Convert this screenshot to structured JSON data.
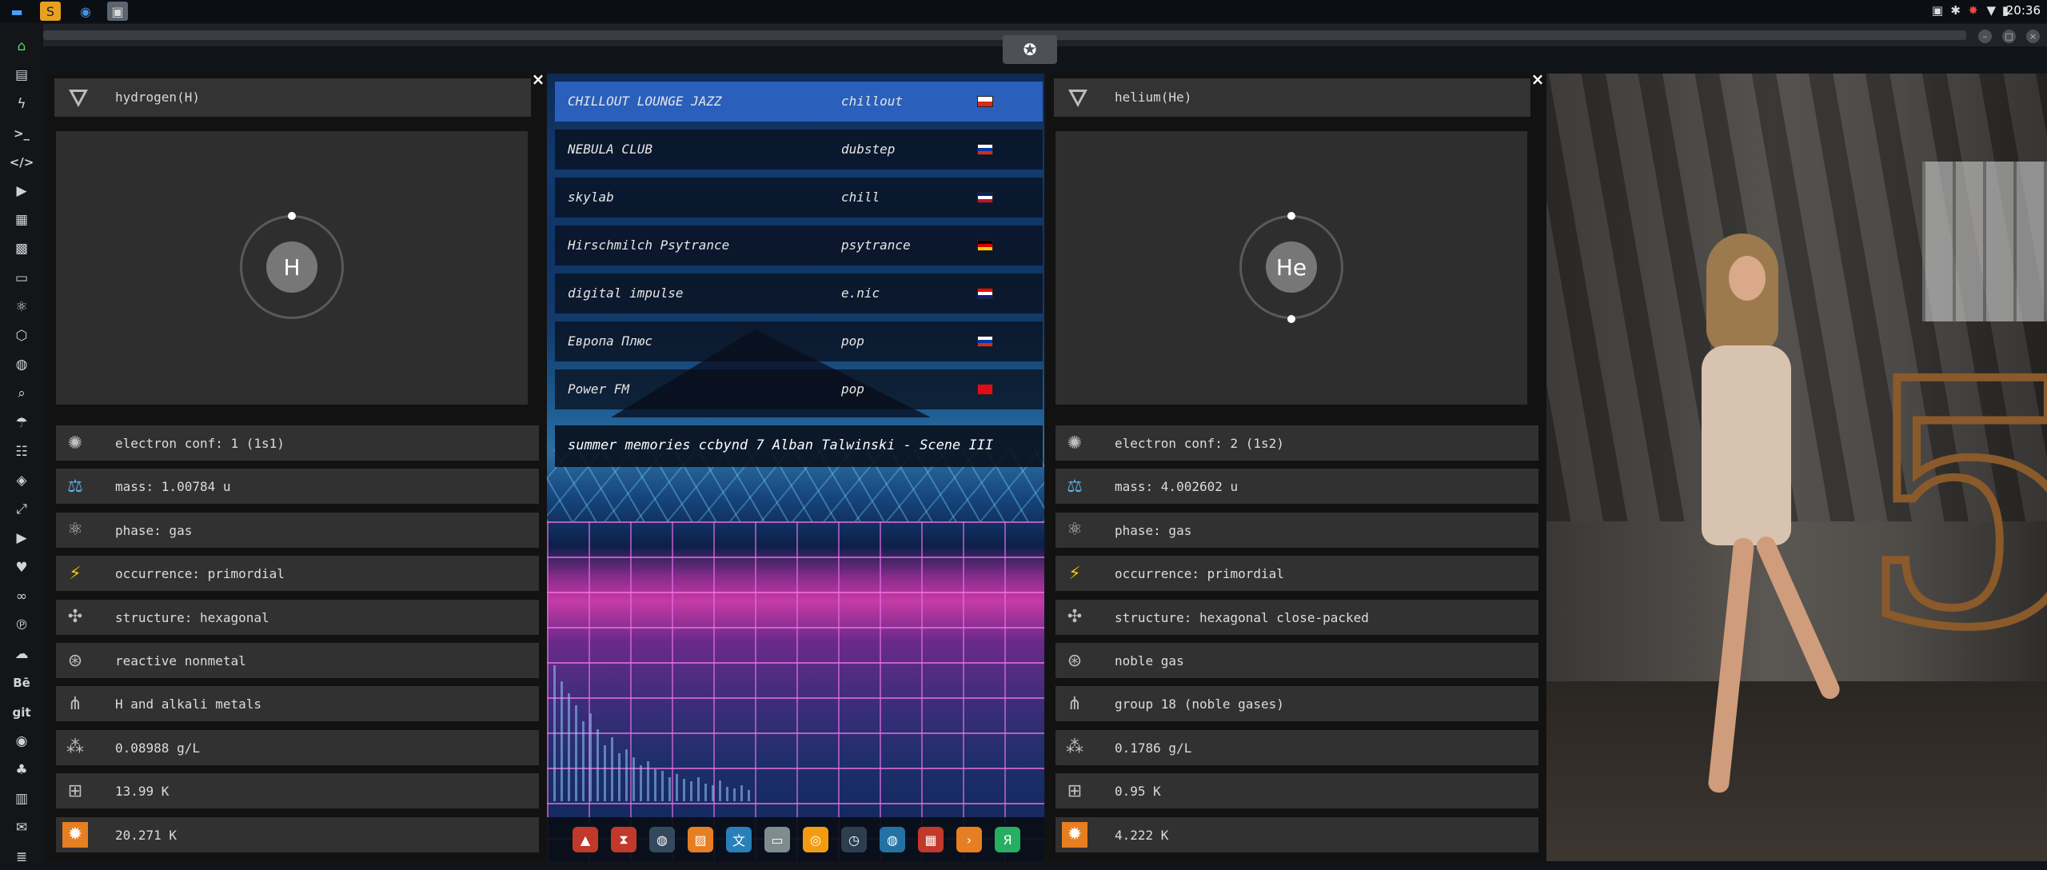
{
  "topbar": {
    "clock": "20:36",
    "tray": [
      "image-icon",
      "bluetooth-icon",
      "alert-icon",
      "wifi-icon",
      "battery-icon"
    ]
  },
  "sidebar": {
    "items": [
      {
        "icon": "home-icon",
        "glyph": "⌂"
      },
      {
        "icon": "document-icon",
        "glyph": "▤"
      },
      {
        "icon": "bolt-icon",
        "glyph": "ϟ"
      },
      {
        "icon": "terminal-icon",
        "glyph": ">_"
      },
      {
        "icon": "code-icon",
        "glyph": "</>"
      },
      {
        "icon": "play-icon",
        "glyph": "▶"
      },
      {
        "icon": "files-icon",
        "glyph": "▦"
      },
      {
        "icon": "image-icon",
        "glyph": "▩"
      },
      {
        "icon": "card-icon",
        "glyph": "▭"
      },
      {
        "icon": "atom-icon",
        "glyph": "⚛"
      },
      {
        "icon": "hex-icon",
        "glyph": "⬡"
      },
      {
        "icon": "globe-icon",
        "glyph": "◍"
      },
      {
        "icon": "search-icon",
        "glyph": "⌕"
      },
      {
        "icon": "umbrella-icon",
        "glyph": "☂"
      },
      {
        "icon": "contact-icon",
        "glyph": "☷"
      },
      {
        "icon": "tag-icon",
        "glyph": "◈"
      },
      {
        "icon": "expand-icon",
        "glyph": "⤢"
      },
      {
        "icon": "youtube-icon",
        "glyph": "▶"
      },
      {
        "icon": "heart-icon",
        "glyph": "♥"
      },
      {
        "icon": "infinity-icon",
        "glyph": "∞"
      },
      {
        "icon": "pinterest-icon",
        "glyph": "℗"
      },
      {
        "icon": "cloud-icon",
        "glyph": "☁"
      },
      {
        "icon": "behance-icon",
        "glyph": "Bē"
      },
      {
        "icon": "git-icon",
        "glyph": "git"
      },
      {
        "icon": "github-icon",
        "glyph": "◉"
      },
      {
        "icon": "gamepad-icon",
        "glyph": "♣"
      },
      {
        "icon": "map-icon",
        "glyph": "▥"
      },
      {
        "icon": "mail-icon",
        "glyph": "✉"
      },
      {
        "icon": "layers-icon",
        "glyph": "≣"
      }
    ]
  },
  "left_panel": {
    "title": "hydrogen(H)",
    "symbol": "H",
    "props": [
      {
        "icon": "atom-shell-icon",
        "glyph": "✺",
        "text": "electron conf: 1 (1s1)"
      },
      {
        "icon": "scale-icon",
        "glyph": "⚖",
        "text": "mass: 1.00784 u"
      },
      {
        "icon": "atom-phase-icon",
        "glyph": "⚛",
        "text": "phase: gas"
      },
      {
        "icon": "lightning-icon",
        "glyph": "⚡",
        "text": "occurrence: primordial"
      },
      {
        "icon": "structure-icon",
        "glyph": "✣",
        "text": "structure: hexagonal"
      },
      {
        "icon": "category-icon",
        "glyph": "⊛",
        "text": "reactive nonmetal"
      },
      {
        "icon": "group-icon",
        "glyph": "⋔",
        "text": "H and alkali metals"
      },
      {
        "icon": "density-icon",
        "glyph": "⁂",
        "text": "0.08988 g/L"
      },
      {
        "icon": "melting-icon",
        "glyph": "⊞",
        "text": "13.99 K"
      },
      {
        "icon": "boiling-icon",
        "glyph": "✹",
        "text": "20.271 K"
      }
    ]
  },
  "right_panel": {
    "title": "helium(He)",
    "symbol": "He",
    "props": [
      {
        "icon": "atom-shell-icon",
        "glyph": "✺",
        "text": "electron conf: 2 (1s2)"
      },
      {
        "icon": "scale-icon",
        "glyph": "⚖",
        "text": "mass: 4.002602 u"
      },
      {
        "icon": "atom-phase-icon",
        "glyph": "⚛",
        "text": "phase: gas"
      },
      {
        "icon": "lightning-icon",
        "glyph": "⚡",
        "text": "occurrence: primordial"
      },
      {
        "icon": "structure-icon",
        "glyph": "✣",
        "text": "structure: hexagonal close-packed"
      },
      {
        "icon": "category-icon",
        "glyph": "⊛",
        "text": "noble gas"
      },
      {
        "icon": "group-icon",
        "glyph": "⋔",
        "text": "group 18 (noble gases)"
      },
      {
        "icon": "density-icon",
        "glyph": "⁂",
        "text": "0.1786 g/L"
      },
      {
        "icon": "melting-icon",
        "glyph": "⊞",
        "text": "0.95 K"
      },
      {
        "icon": "boiling-icon",
        "glyph": "✹",
        "text": "4.222 K"
      }
    ]
  },
  "radio": {
    "stations": [
      {
        "name": "CHILLOUT LOUNGE JAZZ",
        "genre": "chillout",
        "flag": [
          "#ffffff",
          "#d52b1e"
        ],
        "active": true
      },
      {
        "name": "NEBULA CLUB",
        "genre": "dubstep",
        "flag": [
          "#ffffff",
          "#0039a6",
          "#d52b1e"
        ],
        "active": false
      },
      {
        "name": "skylab",
        "genre": "chill",
        "flag": [
          "#012169",
          "#ffffff",
          "#c8102e"
        ],
        "active": false
      },
      {
        "name": "Hirschmilch Psytrance",
        "genre": "psytrance",
        "flag": [
          "#000000",
          "#dd0000",
          "#ffce00"
        ],
        "active": false
      },
      {
        "name": "digital impulse",
        "genre": "e.nic",
        "flag": [
          "#ff0000",
          "#ffffff",
          "#171796"
        ],
        "active": false
      },
      {
        "name": "Европа Плюс",
        "genre": "pop",
        "flag": [
          "#ffffff",
          "#0039a6",
          "#d52b1e"
        ],
        "active": false
      },
      {
        "name": "Power FM",
        "genre": "pop",
        "flag": [
          "#e30a17",
          "#e30a17",
          "#e30a17"
        ],
        "active": false
      }
    ],
    "now_playing": "summer memories ccbynd 7 Alban Talwinski - Scene III",
    "dock": [
      {
        "icon": "triangle-app-icon",
        "glyph": "▲",
        "color": "#c0392b"
      },
      {
        "icon": "hourglass-icon",
        "glyph": "⧗",
        "color": "#c0392b"
      },
      {
        "icon": "planet-icon",
        "glyph": "◍",
        "color": "#34495e"
      },
      {
        "icon": "photos-icon",
        "glyph": "▨",
        "color": "#e67e22"
      },
      {
        "icon": "translate-icon",
        "glyph": "文",
        "color": "#2980b9"
      },
      {
        "icon": "window-icon",
        "glyph": "▭",
        "color": "#7f8c8d"
      },
      {
        "icon": "chrome-icon",
        "glyph": "◎",
        "color": "#f39c12"
      },
      {
        "icon": "clock-icon",
        "glyph": "◷",
        "color": "#2c3e50"
      },
      {
        "icon": "globe-icon",
        "glyph": "◍",
        "color": "#2471a3"
      },
      {
        "icon": "calendar-icon",
        "glyph": "▦",
        "color": "#c0392b"
      },
      {
        "icon": "arrow-icon",
        "glyph": "›",
        "color": "#e67e22"
      },
      {
        "icon": "yandex-icon",
        "glyph": "Я",
        "color": "#27ae60"
      }
    ]
  }
}
